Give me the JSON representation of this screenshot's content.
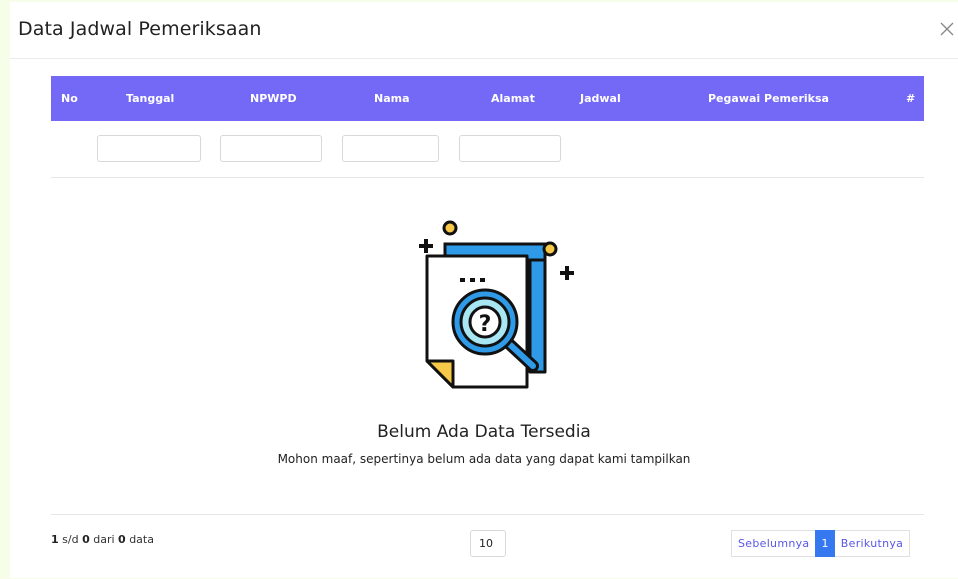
{
  "modal": {
    "title": "Data Jadwal Pemeriksaan",
    "close_icon": "close-icon"
  },
  "table": {
    "columns": [
      "No",
      "Tanggal",
      "NPWPD",
      "Nama",
      "Alamat",
      "Jadwal",
      "Pegawai Pemeriksa",
      "#"
    ],
    "filters": [
      "",
      "",
      "",
      ""
    ],
    "header_color": "#7468f7"
  },
  "empty_state": {
    "icon": "document-search-question-icon",
    "title": "Belum Ada Data Tersedia",
    "subtitle": "Mohon maaf, sepertinya belum ada data yang dapat kami tampilkan"
  },
  "footer": {
    "from": "1",
    "sep": "s/d",
    "to": "0",
    "of_word": "dari",
    "total": "0",
    "data_word": "data",
    "page_size": "10",
    "prev_label": "Sebelumnya",
    "current_page": "1",
    "next_label": "Berikutnya",
    "accent_color": "#3578f0"
  }
}
